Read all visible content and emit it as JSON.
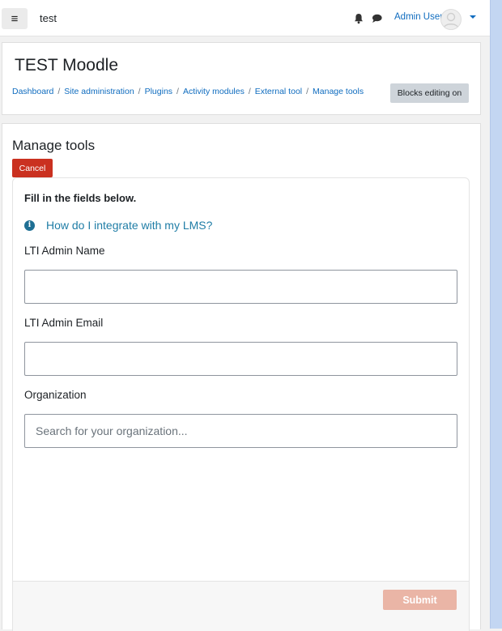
{
  "navbar": {
    "menu_glyph": "≡",
    "site_name": "test",
    "user_name": "Admin User",
    "icons": [
      "menu-icon",
      "bell-icon",
      "chat-icon",
      "avatar-icon",
      "caret-down-icon"
    ]
  },
  "header": {
    "title": "TEST Moodle",
    "breadcrumb": [
      "Dashboard",
      "Site administration",
      "Plugins",
      "Activity modules",
      "External tool",
      "Manage tools"
    ],
    "separator": "/",
    "blocks_editing_label": "Blocks editing on"
  },
  "main": {
    "section_title": "Manage tools",
    "cancel_label": "Cancel"
  },
  "form": {
    "intro": "Fill in the fields below.",
    "info_glyph": "i",
    "help_link": "How do I integrate with my LMS?",
    "fields": [
      {
        "label": "LTI Admin Name",
        "value": "",
        "placeholder": ""
      },
      {
        "label": "LTI Admin Email",
        "value": "",
        "placeholder": ""
      },
      {
        "label": "Organization",
        "value": "",
        "placeholder": "Search for your organization..."
      }
    ],
    "submit_label": "Submit"
  },
  "colors": {
    "link": "#0f6cbf",
    "cancel_bg": "#ca3120",
    "submit_bg_disabled": "#eab5a6",
    "info_icon": "#1f6f94"
  }
}
